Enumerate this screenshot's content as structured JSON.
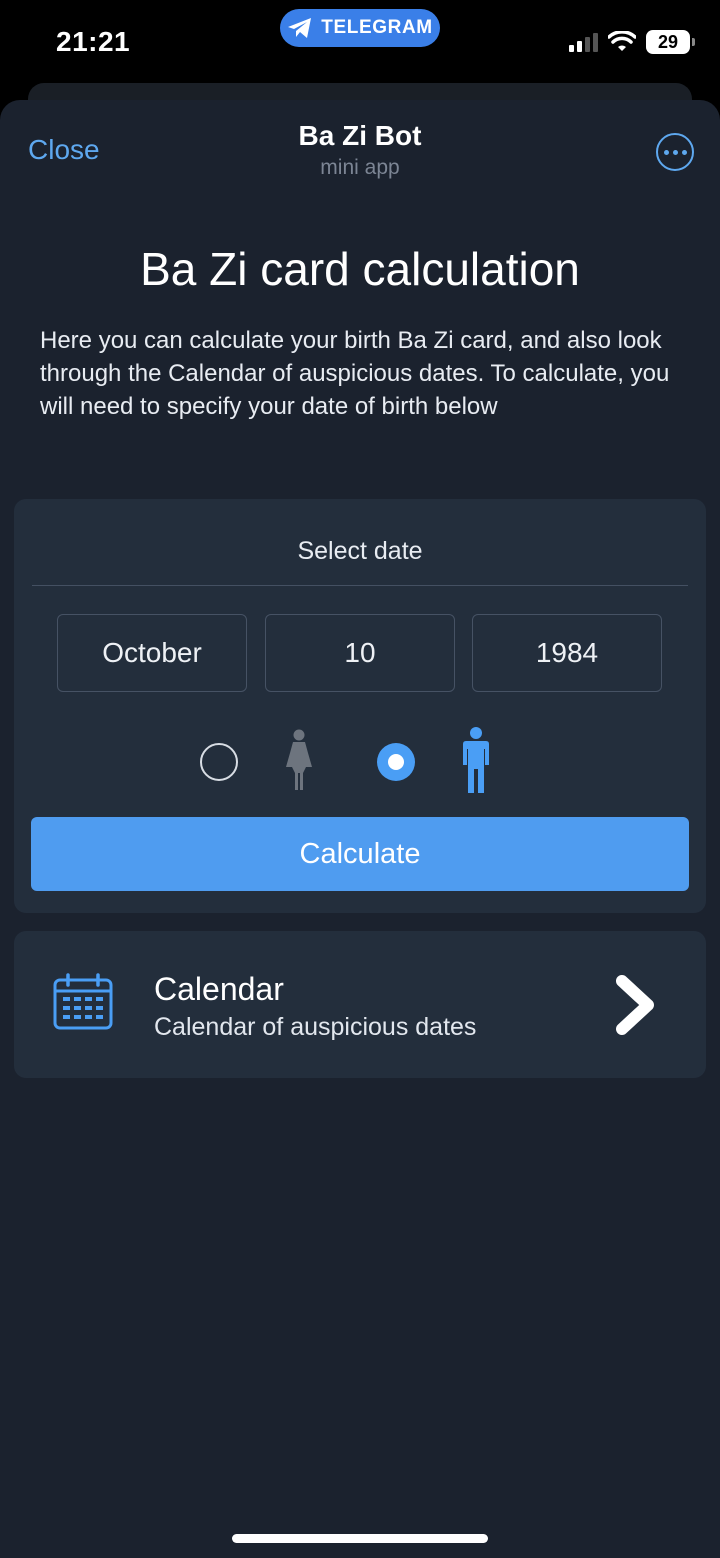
{
  "status_bar": {
    "time": "21:21",
    "source_app": "TELEGRAM",
    "battery": "29"
  },
  "header": {
    "close_label": "Close",
    "title": "Ba Zi Bot",
    "subtitle": "mini app",
    "menu_icon": "ellipsis-icon"
  },
  "main": {
    "heading": "Ba Zi card calculation",
    "description": "Here you can calculate your birth Ba Zi card, and also look through the Calendar of auspicious dates. To calculate, you will need to specify your date of birth below"
  },
  "date_card": {
    "title": "Select date",
    "month": "October",
    "day": "10",
    "year": "1984",
    "gender_options": [
      "female",
      "male"
    ],
    "selected_gender": "male",
    "calculate_label": "Calculate"
  },
  "calendar_card": {
    "title": "Calendar",
    "subtitle": "Calendar of auspicious dates"
  },
  "colors": {
    "accent": "#4f9cf0",
    "link": "#5ea8ef",
    "background": "#1b222e",
    "card": "#232e3c"
  }
}
